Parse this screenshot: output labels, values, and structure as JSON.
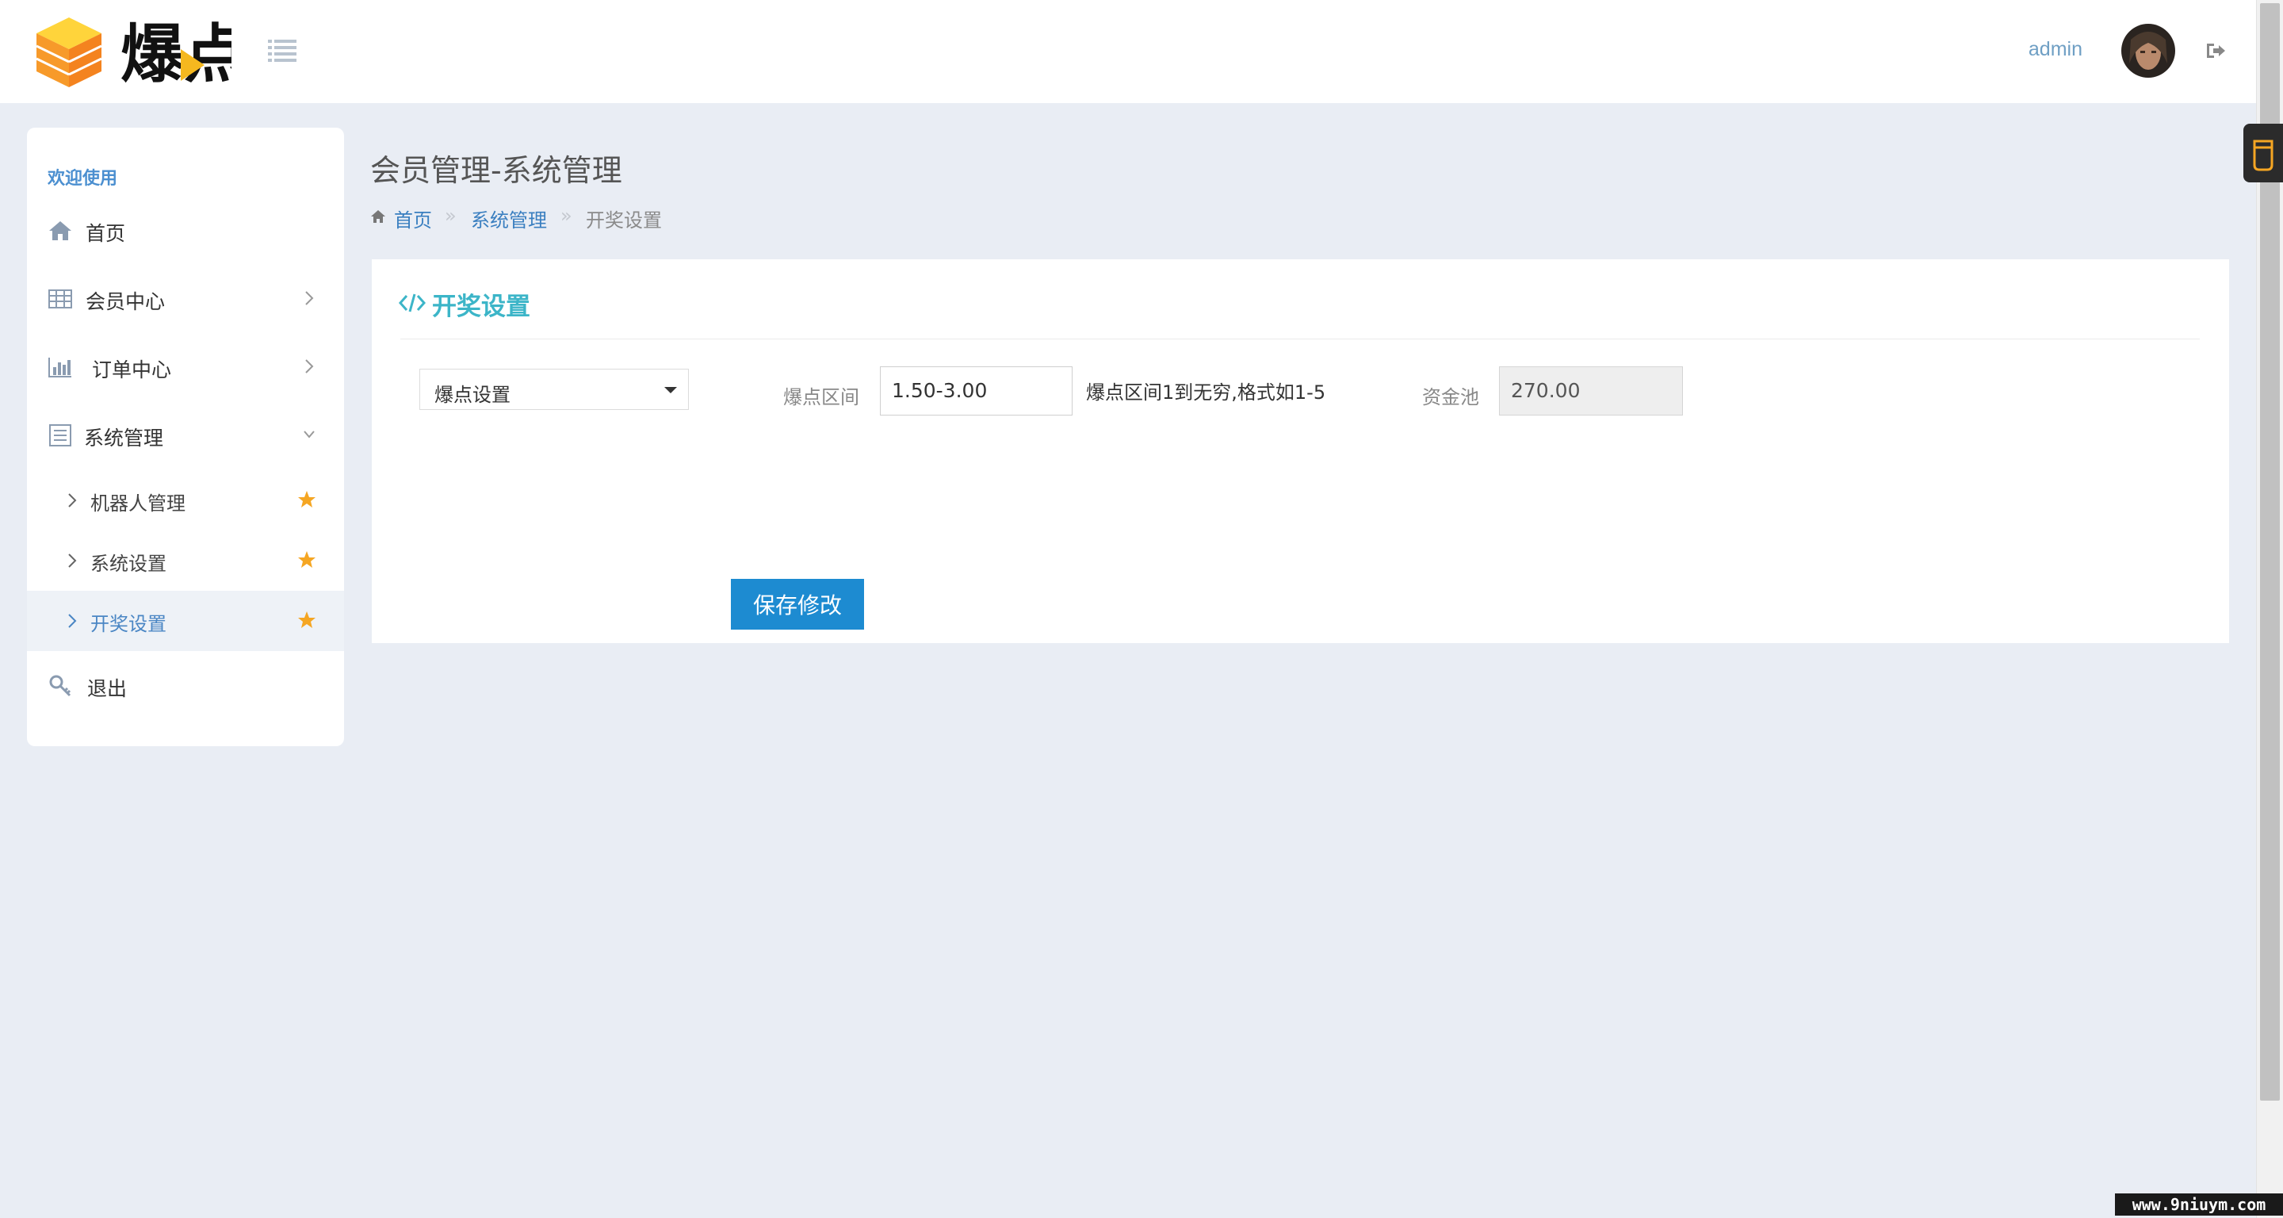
{
  "header": {
    "brand_name": "爆点",
    "admin_name": "admin"
  },
  "sidebar": {
    "welcome": "欢迎使用",
    "items": [
      {
        "label": "首页",
        "icon": "home-icon"
      },
      {
        "label": "会员中心",
        "icon": "table-icon"
      },
      {
        "label": "订单中心",
        "icon": "bar-chart-icon"
      },
      {
        "label": "系统管理",
        "icon": "list-alt-icon"
      }
    ],
    "sub_items": [
      {
        "label": "机器人管理"
      },
      {
        "label": "系统设置"
      },
      {
        "label": "开奖设置",
        "active": true
      }
    ],
    "logout": {
      "label": "退出",
      "icon": "key-icon"
    }
  },
  "page": {
    "title": "会员管理-系统管理",
    "breadcrumb": {
      "home": "首页",
      "separator": "»",
      "parent": "系统管理",
      "current": "开奖设置"
    }
  },
  "panel": {
    "title": "开奖设置",
    "select_value": "爆点设置",
    "range_label": "爆点区间",
    "range_value": "1.50-3.00",
    "range_hint": "爆点区间1到无穷,格式如1-5",
    "pool_label": "资金池",
    "pool_value": "270.00",
    "save_label": "保存修改"
  },
  "watermark": "www.9niuym.com",
  "colors": {
    "accent": "#1d8bd1",
    "panel_title": "#3cb5c8",
    "link": "#3a7fc0",
    "star": "#f5a623",
    "background": "#e9edf4"
  }
}
